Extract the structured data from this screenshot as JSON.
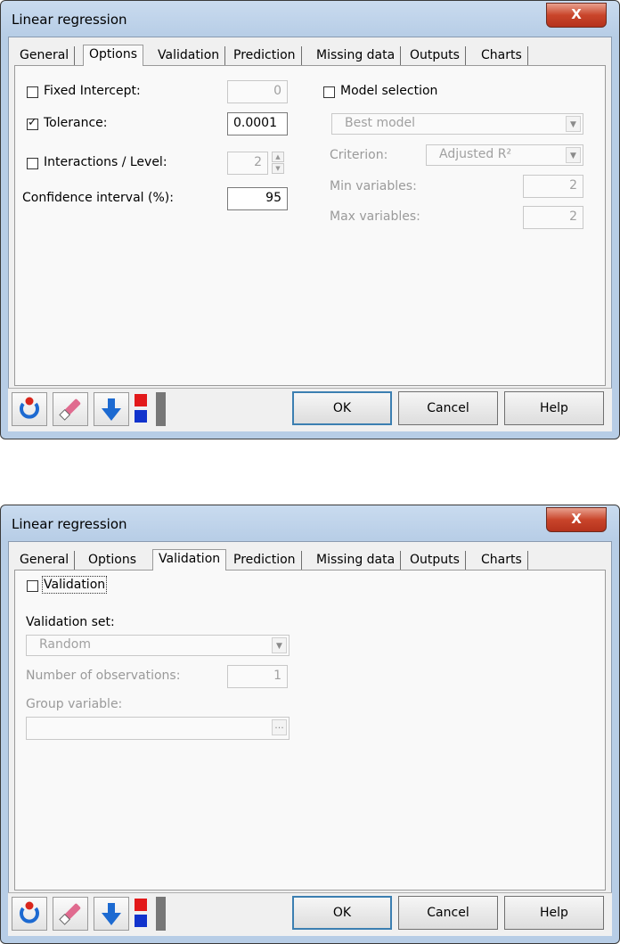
{
  "dialogs": [
    {
      "title": "Linear regression",
      "close_label": "X",
      "tabs": [
        "General",
        "Options",
        "Validation",
        "Prediction",
        "Missing data",
        "Outputs",
        "Charts"
      ],
      "active_tab": "Options",
      "options": {
        "fixed_intercept": {
          "label": "Fixed Intercept:",
          "checked": false,
          "value": "0"
        },
        "tolerance": {
          "label": "Tolerance:",
          "checked": true,
          "value": "0.0001"
        },
        "interactions": {
          "label": "Interactions / Level:",
          "checked": false,
          "value": "2"
        },
        "confidence": {
          "label": "Confidence interval (%):",
          "value": "95"
        },
        "model_selection": {
          "label": "Model selection",
          "checked": false,
          "method": "Best model"
        },
        "criterion": {
          "label": "Criterion:",
          "value": "Adjusted R²"
        },
        "min_variables": {
          "label": "Min variables:",
          "value": "2"
        },
        "max_variables": {
          "label": "Max variables:",
          "value": "2"
        }
      },
      "buttons": {
        "ok": "OK",
        "cancel": "Cancel",
        "help": "Help"
      }
    },
    {
      "title": "Linear regression",
      "close_label": "X",
      "tabs": [
        "General",
        "Options",
        "Validation",
        "Prediction",
        "Missing data",
        "Outputs",
        "Charts"
      ],
      "active_tab": "Validation",
      "validation": {
        "checkbox": {
          "label": "Validation",
          "checked": false
        },
        "set_label": "Validation set:",
        "set_value": "Random",
        "n_obs_label": "Number of observations:",
        "n_obs_value": "1",
        "group_label": "Group variable:",
        "group_value": "",
        "browse_label": "..."
      },
      "buttons": {
        "ok": "OK",
        "cancel": "Cancel",
        "help": "Help"
      }
    }
  ],
  "colors": {
    "title_bg": "#b9d1ea",
    "close_red": "#c7432b",
    "default_button_border": "#3c7fb1"
  },
  "toolbar_icons": [
    "reset-icon",
    "eraser-icon",
    "down-arrow-icon",
    "red-blue-squares-icon",
    "gray-bar-icon"
  ]
}
